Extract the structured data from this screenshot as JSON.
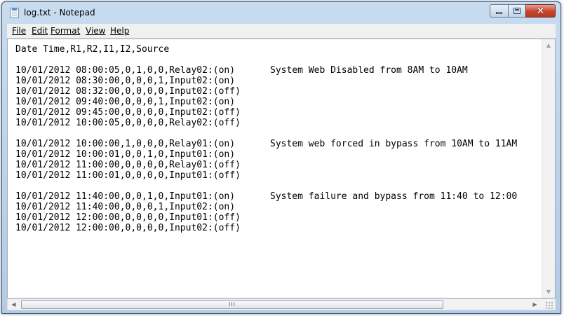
{
  "window": {
    "title": "log.txt - Notepad",
    "icon": "notepad-icon",
    "controls": {
      "minimize": "minimize-icon",
      "maximize": "maximize-icon",
      "close_glyph": "✕"
    }
  },
  "menu": {
    "file": "File",
    "edit": "Edit",
    "format": "Format",
    "view": "View",
    "help": "Help"
  },
  "document": {
    "lines": [
      {
        "text": "Date Time,R1,R2,I1,I2,Source",
        "comment": ""
      },
      {
        "text": "",
        "comment": ""
      },
      {
        "text": "10/01/2012 08:00:05,0,1,0,0,Relay02:(on)",
        "comment": "System Web Disabled from 8AM to 10AM"
      },
      {
        "text": "10/01/2012 08:30:00,0,0,0,1,Input02:(on)",
        "comment": ""
      },
      {
        "text": "10/01/2012 08:32:00,0,0,0,0,Input02:(off)",
        "comment": ""
      },
      {
        "text": "10/01/2012 09:40:00,0,0,0,1,Input02:(on)",
        "comment": ""
      },
      {
        "text": "10/01/2012 09:45:00,0,0,0,0,Input02:(off)",
        "comment": ""
      },
      {
        "text": "10/01/2012 10:00:05,0,0,0,0,Relay02:(off)",
        "comment": ""
      },
      {
        "text": "",
        "comment": ""
      },
      {
        "text": "10/01/2012 10:00:00,1,0,0,0,Relay01:(on)",
        "comment": "System web forced in bypass from 10AM to 11AM"
      },
      {
        "text": "10/01/2012 10:00:01,0,0,1,0,Input01:(on)",
        "comment": ""
      },
      {
        "text": "10/01/2012 11:00:00,0,0,0,0,Relay01:(off)",
        "comment": ""
      },
      {
        "text": "10/01/2012 11:00:01,0,0,0,0,Input01:(off)",
        "comment": ""
      },
      {
        "text": "",
        "comment": ""
      },
      {
        "text": "10/01/2012 11:40:00,0,0,1,0,Input01:(on)",
        "comment": "System failure and bypass from 11:40 to 12:00"
      },
      {
        "text": "10/01/2012 11:40:00,0,0,0,1,Input02:(on)",
        "comment": ""
      },
      {
        "text": "10/01/2012 12:00:00,0,0,0,0,Input01:(off)",
        "comment": ""
      },
      {
        "text": "10/01/2012 12:00:00,0,0,0,0,Input02:(off)",
        "comment": ""
      }
    ]
  },
  "scrollbars": {
    "up_arrow": "▲",
    "down_arrow": "▼",
    "left_arrow": "◀",
    "right_arrow": "▶",
    "thumb_grip": "III"
  }
}
